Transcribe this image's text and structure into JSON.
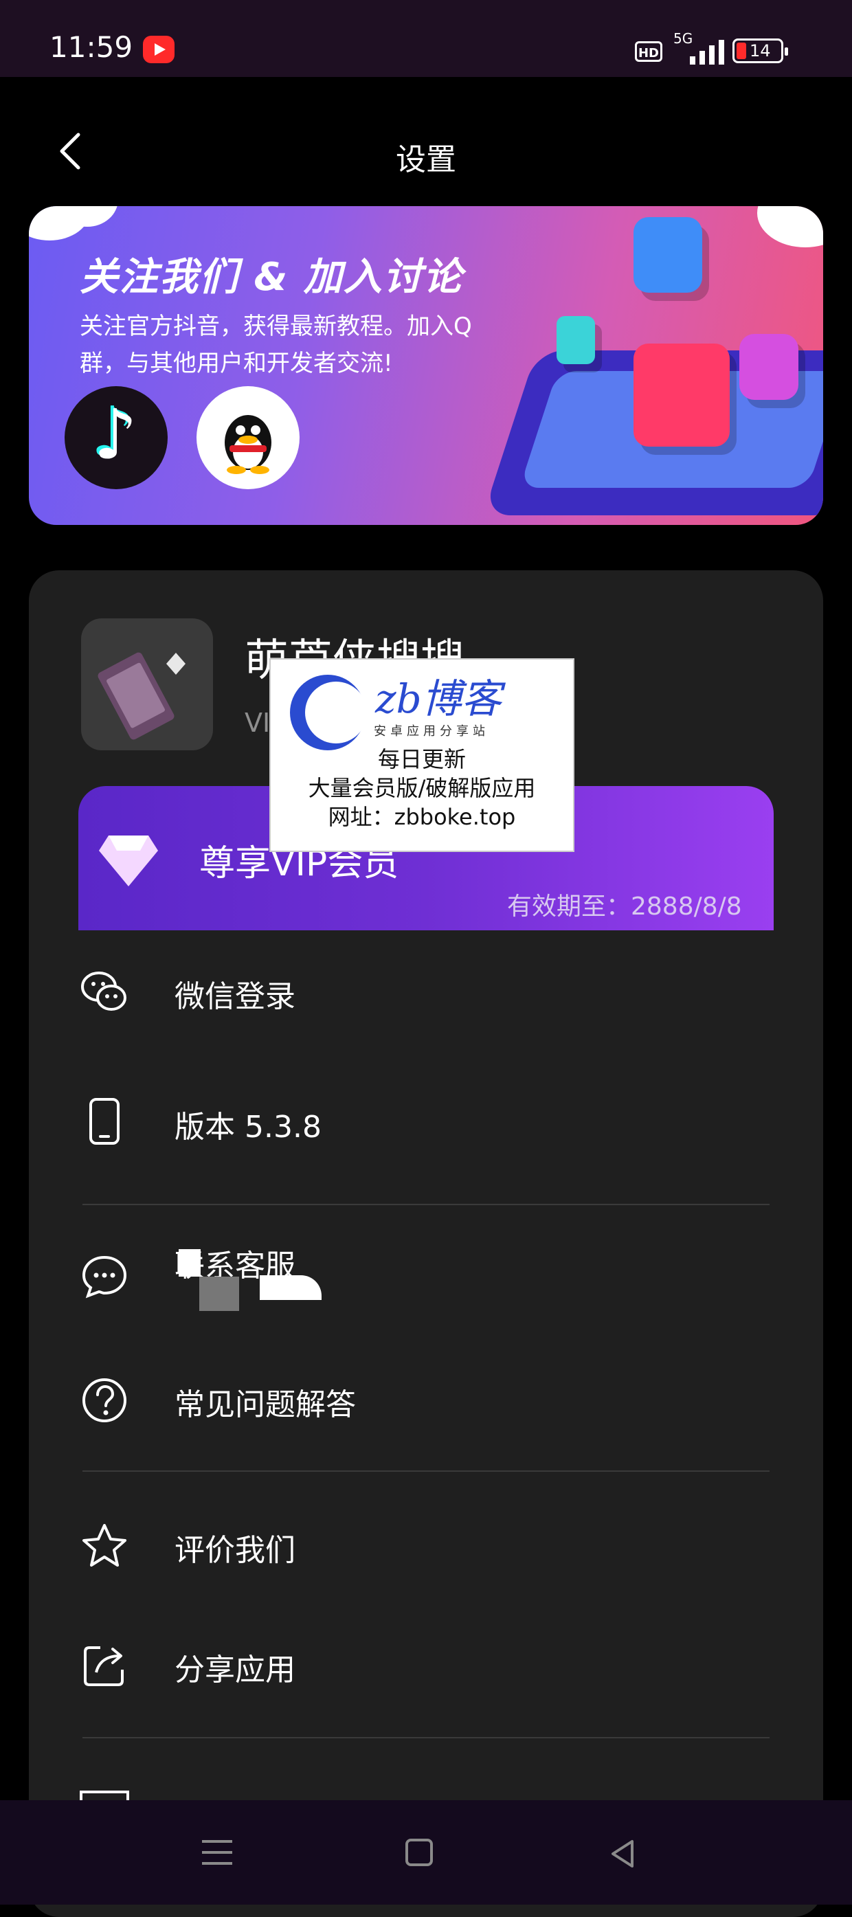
{
  "status_bar": {
    "time": "11:59",
    "network": "5G",
    "hd": "HD",
    "battery": "14"
  },
  "header": {
    "title": "设置"
  },
  "banner": {
    "title": "关注我们 & 加入讨论",
    "description": "关注官方抖音，获得最新教程。加入Q群，与其他用户和开发者交流!"
  },
  "app": {
    "name": "萌芦侠搜搜",
    "sub": "VI"
  },
  "vip": {
    "title": "尊享VIP会员",
    "expire": "有效期至：2888/8/8"
  },
  "menu": [
    {
      "label": "微信登录",
      "icon": "wechat-icon"
    },
    {
      "label": "版本 5.3.8",
      "icon": "phone-icon"
    },
    {
      "label": "联系客服",
      "icon": "chat-bubble-icon"
    },
    {
      "label": "常见问题解答",
      "icon": "help-icon"
    },
    {
      "label": "评价我们",
      "icon": "star-icon"
    },
    {
      "label": "分享应用",
      "icon": "share-icon"
    }
  ],
  "watermark": {
    "brand": "zb博客",
    "tagline": "安卓应用分享站",
    "line1": "每日更新",
    "line2": "大量会员版/破解版应用",
    "line3": "网址：zbboke.top"
  },
  "colors": {
    "accent": "#6f2fd4",
    "background": "#000000",
    "card": "#1f1f1f"
  }
}
